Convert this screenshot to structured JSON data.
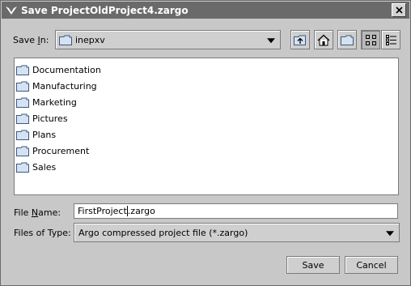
{
  "window": {
    "title": "Save ProjectOldProject4.zargo"
  },
  "save_in": {
    "label_pre": "Save ",
    "label_mnemonic": "I",
    "label_post": "n:",
    "value": "inepxv"
  },
  "toolbar": {
    "buttons": [
      "up-one-level",
      "home",
      "new-folder",
      "list-view",
      "details-view"
    ]
  },
  "files": [
    {
      "name": "Documentation"
    },
    {
      "name": "Manufacturing"
    },
    {
      "name": "Marketing"
    },
    {
      "name": "Pictures"
    },
    {
      "name": "Plans"
    },
    {
      "name": "Procurement"
    },
    {
      "name": "Sales"
    }
  ],
  "file_name": {
    "label_pre": "File ",
    "label_mnemonic": "N",
    "label_post": "ame:",
    "value_before_caret": "FirstProject",
    "value_after_caret": ".zargo"
  },
  "file_type": {
    "label": "Files of Type:",
    "value": "Argo compressed project file (*.zargo)"
  },
  "buttons": {
    "save": "Save",
    "cancel": "Cancel"
  }
}
